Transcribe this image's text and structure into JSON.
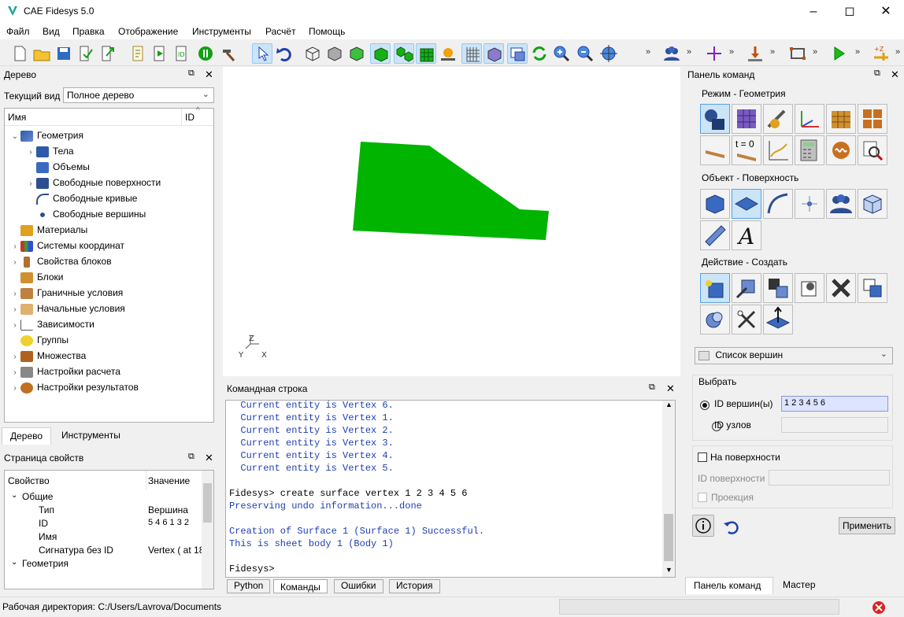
{
  "app": {
    "title": "CAE Fidesys 5.0"
  },
  "menu": [
    "Файл",
    "Вид",
    "Правка",
    "Отображение",
    "Инструменты",
    "Расчёт",
    "Помощь"
  ],
  "tree_panel": {
    "title": "Дерево",
    "current_view_label": "Текущий вид",
    "current_view_value": "Полное дерево",
    "col_name": "Имя",
    "col_id": "ID",
    "items": [
      {
        "label": "Геометрия",
        "icon": "geometry-icon"
      },
      {
        "label": "Тела",
        "icon": "bodies-icon"
      },
      {
        "label": "Объемы",
        "icon": "volumes-icon"
      },
      {
        "label": "Свободные поверхности",
        "icon": "surfaces-icon"
      },
      {
        "label": "Свободные кривые",
        "icon": "curves-icon"
      },
      {
        "label": "Свободные вершины",
        "icon": "vertices-icon"
      },
      {
        "label": "Материалы",
        "icon": "materials-icon"
      },
      {
        "label": "Системы координат",
        "icon": "coordinate-systems-icon"
      },
      {
        "label": "Свойства блоков",
        "icon": "block-properties-icon"
      },
      {
        "label": "Блоки",
        "icon": "blocks-icon"
      },
      {
        "label": "Граничные условия",
        "icon": "boundary-conditions-icon"
      },
      {
        "label": "Начальные условия",
        "icon": "initial-conditions-icon"
      },
      {
        "label": "Зависимости",
        "icon": "dependencies-icon"
      },
      {
        "label": "Группы",
        "icon": "groups-icon"
      },
      {
        "label": "Множества",
        "icon": "sets-icon"
      },
      {
        "label": "Настройки расчета",
        "icon": "analysis-settings-icon"
      },
      {
        "label": "Настройки результатов",
        "icon": "results-settings-icon"
      }
    ],
    "tabs": [
      "Дерево",
      "Инструменты"
    ]
  },
  "props_panel": {
    "title": "Страница свойств",
    "col_prop": "Свойство",
    "col_value": "Значение",
    "group_general": "Общие",
    "rows": [
      {
        "k": "Тип",
        "v": "Вершина"
      },
      {
        "k": "ID",
        "v": "5 4 6 1 3 2"
      },
      {
        "k": "Имя",
        "v": ""
      },
      {
        "k": "Сигнатура без ID",
        "v": "Vertex ( at 18"
      }
    ],
    "group_geometry": "Геометрия"
  },
  "console": {
    "title": "Командная строка",
    "lines": [
      {
        "t": "  Current entity is Vertex 6.",
        "c": "blue"
      },
      {
        "t": "  Current entity is Vertex 1.",
        "c": "blue"
      },
      {
        "t": "  Current entity is Vertex 2.",
        "c": "blue"
      },
      {
        "t": "  Current entity is Vertex 3.",
        "c": "blue"
      },
      {
        "t": "  Current entity is Vertex 4.",
        "c": "blue"
      },
      {
        "t": "  Current entity is Vertex 5.",
        "c": "blue"
      },
      {
        "t": "",
        "c": ""
      },
      {
        "t": "Fidesys> create surface vertex 1 2 3 4 5 6",
        "c": "black"
      },
      {
        "t": "Preserving undo information...done",
        "c": "blue"
      },
      {
        "t": "",
        "c": ""
      },
      {
        "t": "Creation of Surface 1 (Surface 1) Successful.",
        "c": "blue"
      },
      {
        "t": "This is sheet body 1 (Body 1)",
        "c": "blue"
      },
      {
        "t": "",
        "c": ""
      },
      {
        "t": "Fidesys>",
        "c": "black"
      }
    ],
    "tabs": [
      "Python",
      "Команды",
      "Ошибки",
      "История"
    ]
  },
  "axes": {
    "z": "Z",
    "y": "Y",
    "x": "X"
  },
  "command_panel": {
    "title": "Панель команд",
    "mode_title": "Режим - Геометрия",
    "object_title": "Объект - Поверхность",
    "action_title": "Действие - Создать",
    "t0_label": "t = 0",
    "list_select": "Список вершин",
    "select_title": "Выбрать",
    "vertex_id_label": "ID вершин(ы)",
    "vertex_id_value": "1 2 3 4 5 6",
    "node_id_label": "ID узлов",
    "on_surface_label": "На поверхности",
    "surface_id_label": "ID поверхности",
    "projection_label": "Проекция",
    "apply_label": "Применить",
    "tabs": [
      "Панель команд",
      "Мастер"
    ]
  },
  "status": {
    "workdir": "Рабочая директория: C:/Users/Lavrova/Documents"
  },
  "colors": {
    "surface": "#00b400",
    "accent": "#cce4f7"
  }
}
